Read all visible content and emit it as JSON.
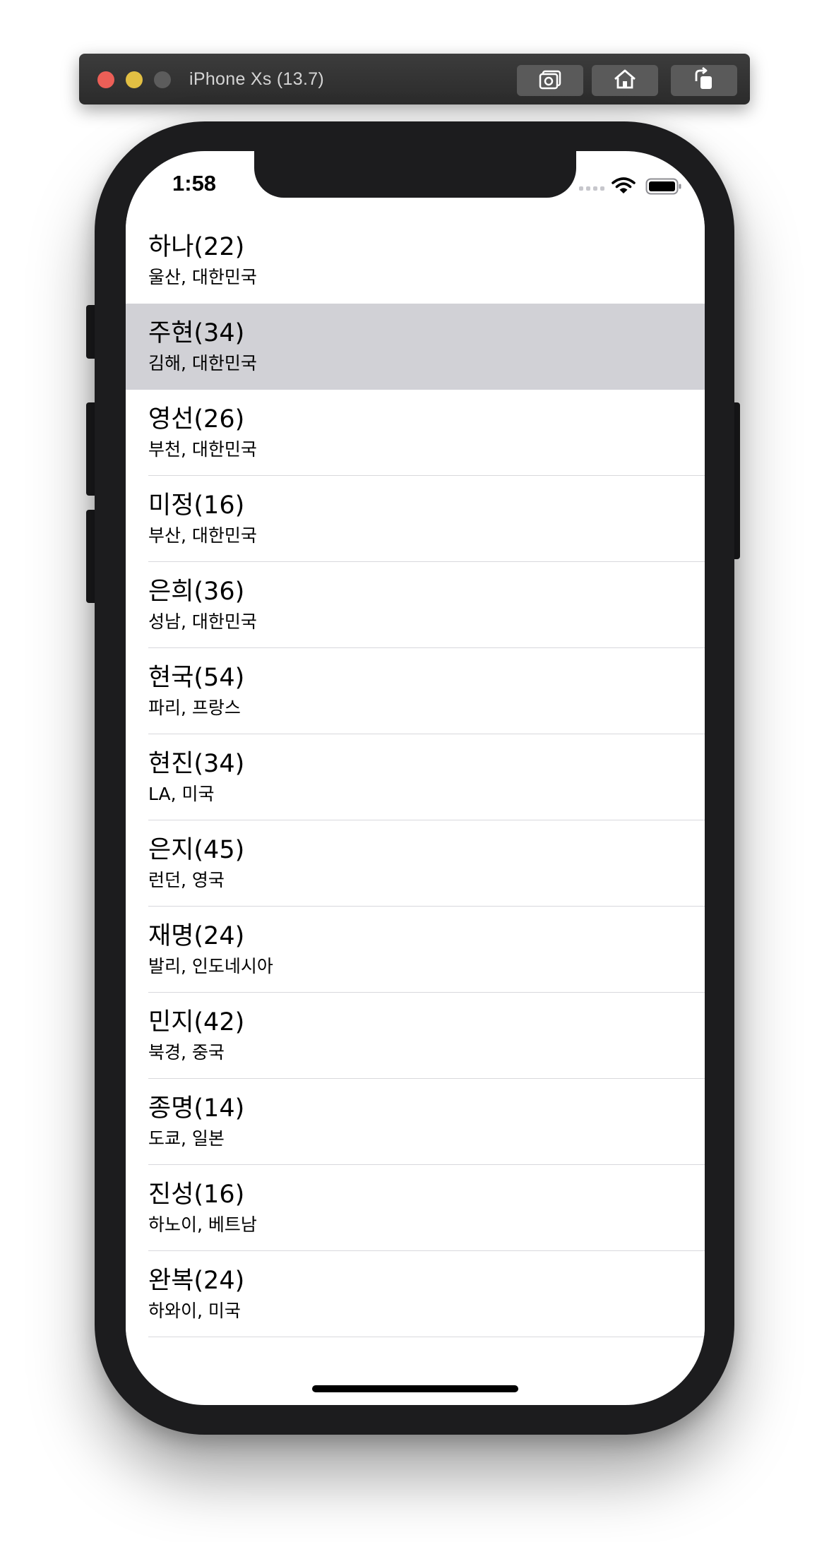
{
  "window": {
    "title": "iPhone Xs (13.7)",
    "buttons": [
      {
        "icon": "camera-icon"
      },
      {
        "icon": "home-icon"
      },
      {
        "icon": "rotate-icon"
      }
    ]
  },
  "status_bar": {
    "time": "1:58",
    "wifi_icon": "wifi-icon",
    "battery_icon": "battery-icon"
  },
  "list": {
    "selected_index": 1,
    "items": [
      {
        "title": "하나(22)",
        "subtitle": "울산, 대한민국"
      },
      {
        "title": "주현(34)",
        "subtitle": "김해, 대한민국"
      },
      {
        "title": "영선(26)",
        "subtitle": "부천, 대한민국"
      },
      {
        "title": "미정(16)",
        "subtitle": "부산, 대한민국"
      },
      {
        "title": "은희(36)",
        "subtitle": "성남, 대한민국"
      },
      {
        "title": "현국(54)",
        "subtitle": "파리, 프랑스"
      },
      {
        "title": "현진(34)",
        "subtitle": "LA, 미국"
      },
      {
        "title": "은지(45)",
        "subtitle": "런던, 영국"
      },
      {
        "title": "재명(24)",
        "subtitle": "발리, 인도네시아"
      },
      {
        "title": "민지(42)",
        "subtitle": "북경, 중국"
      },
      {
        "title": "종명(14)",
        "subtitle": "도쿄, 일본"
      },
      {
        "title": "진성(16)",
        "subtitle": "하노이, 베트남"
      },
      {
        "title": "완복(24)",
        "subtitle": "하와이, 미국"
      }
    ]
  },
  "colors": {
    "selected_row": "#d1d1d6",
    "separator": "#d8d8dc",
    "device_frame": "#1c1c1e"
  }
}
